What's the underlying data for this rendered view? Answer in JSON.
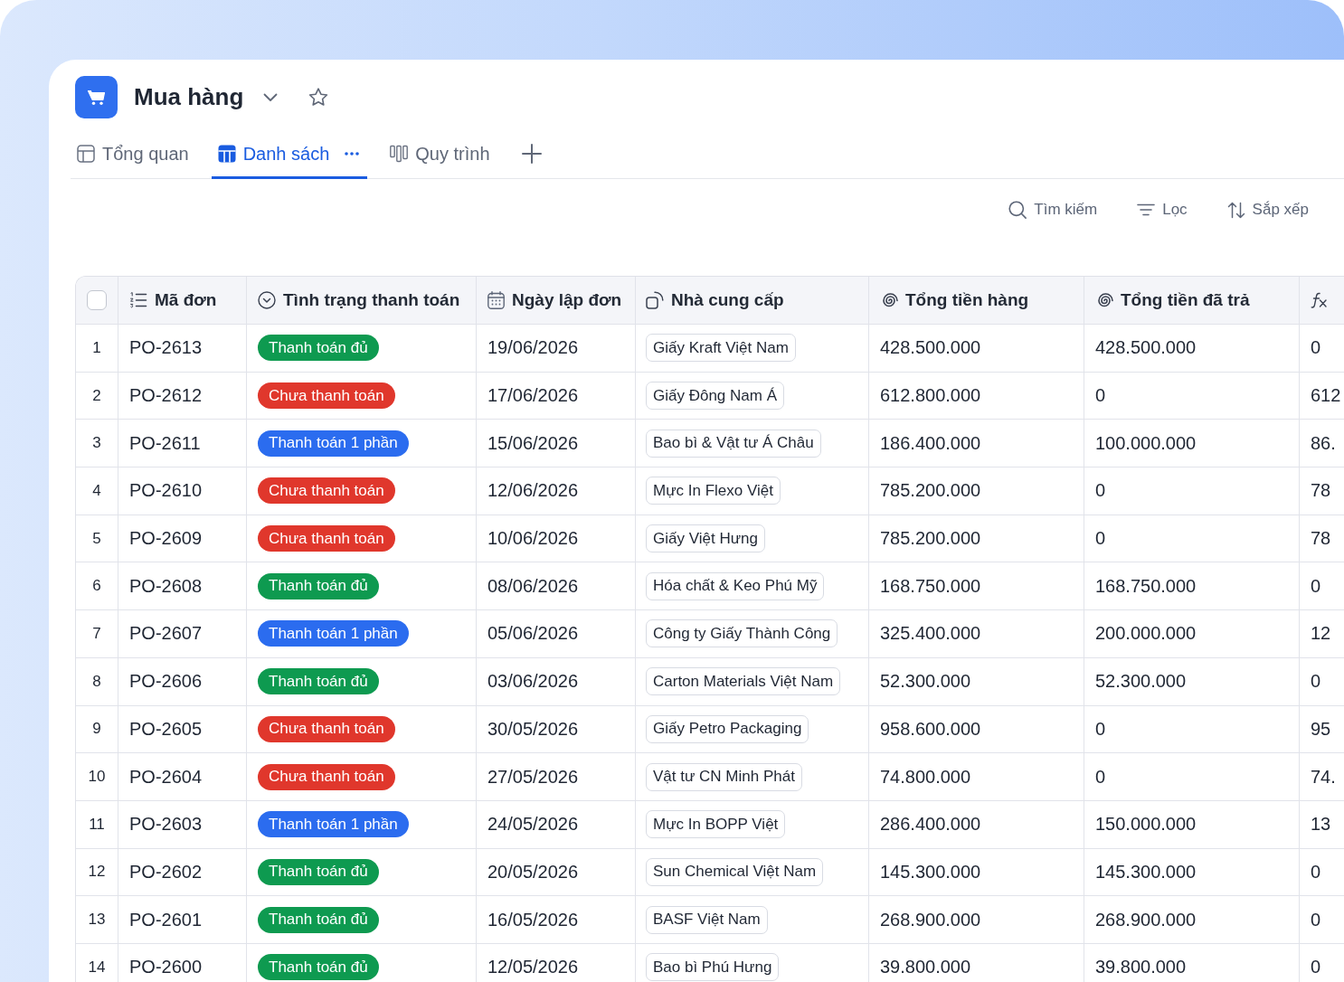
{
  "app": {
    "title": "Mua hàng"
  },
  "tabs": [
    {
      "label": "Tổng quan",
      "kind": "overview",
      "selected": false
    },
    {
      "label": "Danh sách",
      "kind": "table",
      "selected": true
    },
    {
      "label": "Quy trình",
      "kind": "kanban",
      "selected": false
    }
  ],
  "toolbar": [
    {
      "label": "Tìm kiếm",
      "kind": "search"
    },
    {
      "label": "Lọc",
      "kind": "filter"
    },
    {
      "label": "Sắp xếp",
      "kind": "sort"
    }
  ],
  "table": {
    "select_all": {
      "checked": false
    },
    "columns": [
      {
        "label": "Mã đơn",
        "kind": "autonumber"
      },
      {
        "label": "Tình trạng thanh toán",
        "kind": "status"
      },
      {
        "label": "Ngày lập đơn",
        "kind": "date"
      },
      {
        "label": "Nhà cung cấp",
        "kind": "relation"
      },
      {
        "label": "Tổng tiền hàng",
        "kind": "rollup"
      },
      {
        "label": "Tổng tiền đã trả",
        "kind": "rollup"
      },
      {
        "kind": "formula"
      }
    ],
    "rows": [
      {
        "row_number": "1",
        "code": "PO-2613",
        "status": {
          "label": "Thanh toán đủ",
          "color": "#0e9a50"
        },
        "date": "19/06/2026",
        "supplier": "Giấy Kraft Việt Nam",
        "total": "428.500.000",
        "paid": "428.500.000",
        "column_7": "0"
      },
      {
        "row_number": "2",
        "code": "PO-2612",
        "status": {
          "label": "Chưa thanh toán",
          "color": "#e0372c"
        },
        "date": "17/06/2026",
        "supplier": "Giấy Đông Nam Á",
        "total": "612.800.000",
        "paid": "0",
        "column_7": "612"
      },
      {
        "row_number": "3",
        "code": "PO-2611",
        "status": {
          "label": "Thanh toán 1 phần",
          "color": "#2b6cef"
        },
        "date": "15/06/2026",
        "supplier": "Bao bì & Vật tư Á Châu",
        "total": "186.400.000",
        "paid": "100.000.000",
        "column_7": "86."
      },
      {
        "row_number": "4",
        "code": "PO-2610",
        "status": {
          "label": "Chưa thanh toán",
          "color": "#e0372c"
        },
        "date": "12/06/2026",
        "supplier": "Mực In Flexo Việt",
        "total": "785.200.000",
        "paid": "0",
        "column_7": "78"
      },
      {
        "row_number": "5",
        "code": "PO-2609",
        "status": {
          "label": "Chưa thanh toán",
          "color": "#e0372c"
        },
        "date": "10/06/2026",
        "supplier": "Giấy Việt Hưng",
        "total": "785.200.000",
        "paid": "0",
        "column_7": "78"
      },
      {
        "row_number": "6",
        "code": "PO-2608",
        "status": {
          "label": "Thanh toán đủ",
          "color": "#0e9a50"
        },
        "date": "08/06/2026",
        "supplier": "Hóa chất & Keo Phú Mỹ",
        "total": "168.750.000",
        "paid": "168.750.000",
        "column_7": "0"
      },
      {
        "row_number": "7",
        "code": "PO-2607",
        "status": {
          "label": "Thanh toán 1 phần",
          "color": "#2b6cef"
        },
        "date": "05/06/2026",
        "supplier": "Công ty Giấy Thành Công",
        "total": "325.400.000",
        "paid": "200.000.000",
        "column_7": "12"
      },
      {
        "row_number": "8",
        "code": "PO-2606",
        "status": {
          "label": "Thanh toán đủ",
          "color": "#0e9a50"
        },
        "date": "03/06/2026",
        "supplier": "Carton Materials Việt Nam",
        "total": "52.300.000",
        "paid": "52.300.000",
        "column_7": "0"
      },
      {
        "row_number": "9",
        "code": "PO-2605",
        "status": {
          "label": "Chưa thanh toán",
          "color": "#e0372c"
        },
        "date": "30/05/2026",
        "supplier": "Giấy Petro Packaging",
        "total": "958.600.000",
        "paid": "0",
        "column_7": "95"
      },
      {
        "row_number": "10",
        "code": "PO-2604",
        "status": {
          "label": "Chưa thanh toán",
          "color": "#e0372c"
        },
        "date": "27/05/2026",
        "supplier": "Vật tư CN Minh Phát",
        "total": "74.800.000",
        "paid": "0",
        "column_7": "74."
      },
      {
        "row_number": "11",
        "code": "PO-2603",
        "status": {
          "label": "Thanh toán 1 phần",
          "color": "#2b6cef"
        },
        "date": "24/05/2026",
        "supplier": "Mực In BOPP Việt",
        "total": "286.400.000",
        "paid": "150.000.000",
        "column_7": "13"
      },
      {
        "row_number": "12",
        "code": "PO-2602",
        "status": {
          "label": "Thanh toán đủ",
          "color": "#0e9a50"
        },
        "date": "20/05/2026",
        "supplier": "Sun Chemical Việt Nam",
        "total": "145.300.000",
        "paid": "145.300.000",
        "column_7": "0"
      },
      {
        "row_number": "13",
        "code": "PO-2601",
        "status": {
          "label": "Thanh toán đủ",
          "color": "#0e9a50"
        },
        "date": "16/05/2026",
        "supplier": "BASF Việt Nam",
        "total": "268.900.000",
        "paid": "268.900.000",
        "column_7": "0"
      },
      {
        "row_number": "14",
        "code": "PO-2600",
        "status": {
          "label": "Thanh toán đủ",
          "color": "#0e9a50"
        },
        "date": "12/05/2026",
        "supplier": "Bao bì Phú Hưng",
        "total": "39.800.000",
        "paid": "39.800.000",
        "column_7": "0"
      }
    ]
  }
}
